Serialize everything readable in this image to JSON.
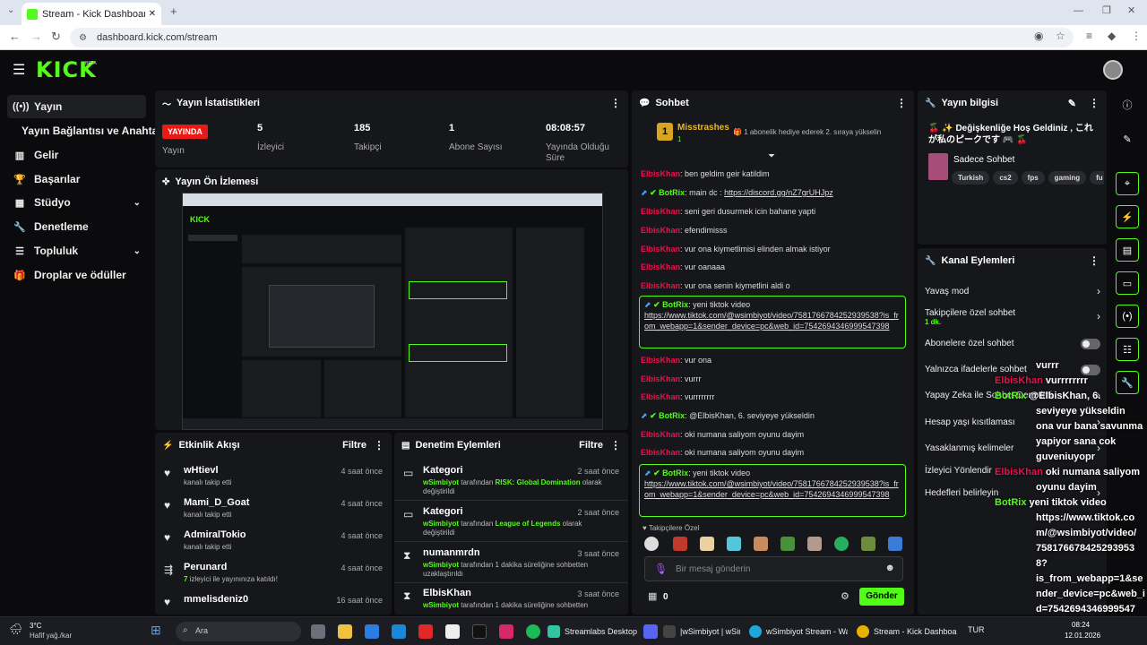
{
  "browser": {
    "tab_title": "Stream - Kick Dashboard",
    "url": "dashboard.kick.com/stream"
  },
  "header": {
    "logo": "KICK",
    "beta": "BETA"
  },
  "sidebar": {
    "items": [
      {
        "label": "Yayın",
        "icon": "broadcast-icon",
        "active": true
      },
      {
        "label": "Yayın Bağlantısı ve Anahtarı",
        "icon": "",
        "active": false
      },
      {
        "label": "Gelir",
        "icon": "revenue-icon",
        "active": false
      },
      {
        "label": "Başarılar",
        "icon": "trophy-icon",
        "active": false
      },
      {
        "label": "Stüdyo",
        "icon": "studio-icon",
        "active": false
      },
      {
        "label": "Denetleme",
        "icon": "wrench-icon",
        "active": false
      },
      {
        "label": "Topluluk",
        "icon": "community-icon",
        "active": false
      },
      {
        "label": "Droplar ve ödüller",
        "icon": "gift-icon",
        "active": false
      }
    ]
  },
  "stats": {
    "title": "Yayın İstatistikleri",
    "live": "YAYINDA",
    "live_label": "Yayın",
    "items": [
      {
        "value": "5",
        "label": "İzleyici"
      },
      {
        "value": "185",
        "label": "Takipçi"
      },
      {
        "value": "1",
        "label": "Abone Sayısı"
      },
      {
        "value": "08:08:57",
        "label": "Yayında Olduğu Süre"
      }
    ]
  },
  "preview": {
    "title": "Yayın Ön İzlemesi"
  },
  "activity": {
    "title": "Etkinlik Akışı",
    "filter": "Filtre",
    "items": [
      {
        "name": "wHtievl",
        "sub": "kanalı takip etti",
        "time": "4 saat önce",
        "icon": "heart-icon"
      },
      {
        "name": "Mami_D_Goat",
        "sub": "kanalı takip etti",
        "time": "4 saat önce",
        "icon": "heart-icon"
      },
      {
        "name": "AdmiralTokio",
        "sub": "kanalı takip etti",
        "time": "4 saat önce",
        "icon": "heart-icon"
      },
      {
        "name": "Perunard",
        "sub_green": "7",
        "sub": " izleyici ile yayınınıza katıldı!",
        "time": "4 saat önce",
        "icon": "raid-icon"
      },
      {
        "name": "mmelisdeniz0",
        "sub": "",
        "time": "16 saat önce",
        "icon": "heart-icon"
      }
    ]
  },
  "moderation": {
    "title": "Denetim Eylemleri",
    "filter": "Filtre",
    "items": [
      {
        "title": "Kategori",
        "user": "wSimbiyot",
        "mid": " tarafından ",
        "hl": "RISK: Global Domination",
        "end": " olarak değiştirildi",
        "time": "2 saat önce",
        "icon": "category-icon"
      },
      {
        "title": "Kategori",
        "user": "wSimbiyot",
        "mid": " tarafından ",
        "hl": "League of Legends",
        "end": " olarak değiştirildi",
        "time": "2 saat önce",
        "icon": "category-icon"
      },
      {
        "title": "numanmrdn",
        "user": "wSimbiyot",
        "mid": " tarafından 1 dakika süreliğine sohbetten uzaklaştırıldı",
        "hl": "",
        "end": "",
        "time": "3 saat önce",
        "icon": "hourglass-icon"
      },
      {
        "title": "ElbisKhan",
        "user": "wSimbiyot",
        "mid": " tarafından 1 dakika süreliğine sohbetten",
        "hl": "",
        "end": "",
        "time": "3 saat önce",
        "icon": "hourglass-icon"
      }
    ]
  },
  "chat": {
    "title": "Sohbet",
    "pinned": {
      "user": "Misstrashes",
      "count": "1",
      "text": "1 abonelik hediye ederek 2. sıraya yükselin"
    },
    "messages": [
      {
        "user": "ElbisKhan",
        "text": "ben geldim geir katildim"
      },
      {
        "user": "BotRix",
        "text": "main dc : ",
        "link": "https://discord.gg/nZ7grUHJpz",
        "bot": true
      },
      {
        "user": "ElbisKhan",
        "text": "seni geri dusurmek icin bahane yapti"
      },
      {
        "user": "ElbisKhan",
        "text": "efendimisss"
      },
      {
        "user": "ElbisKhan",
        "text": "vur ona kiymetlimisi elinden almak istiyor"
      },
      {
        "user": "ElbisKhan",
        "text": "vur oanaaa"
      },
      {
        "user": "ElbisKhan",
        "text": "vur ona senin kiymetlini aldi o"
      },
      {
        "user": "BotRix",
        "text": "yeni tiktok video",
        "link": "https://www.tiktok.com/@wsimbiyot/video/7581766784252939538?is_from_webapp=1&sender_device=pc&web_id=7542694346999547398",
        "bot": true
      },
      {
        "user": "ElbisKhan",
        "text": "vur ona"
      },
      {
        "user": "ElbisKhan",
        "text": "vurrr"
      },
      {
        "user": "ElbisKhan",
        "text": "vurrrrrrrr"
      },
      {
        "user": "BotRix",
        "text": "@ElbisKhan, 6. seviyeye yükseldin",
        "bot": true
      },
      {
        "user": "ElbisKhan",
        "text": "oki numana saliyom oyunu dayim"
      },
      {
        "user": "ElbisKhan",
        "text": "oki numana saliyom oyunu dayim"
      },
      {
        "user": "BotRix",
        "text": "yeni tiktok video",
        "link": "https://www.tiktok.com/@wsimbiyot/video/7581766784252939538?is_from_webapp=1&sender_device=pc&web_id=7542694346999547398",
        "bot": true
      }
    ],
    "followers_only": "Takipçilere Özel",
    "placeholder": "Bir mesaj gönderin",
    "count": "0",
    "send": "Gönder"
  },
  "info": {
    "title": "Yayın bilgisi",
    "stream_title": "🍒 ✨ Değişkenliğe Hoş Geldiniz , これが私のピークです 🎮 🍒",
    "category": "Sadece Sohbet",
    "tags": [
      "Turkish",
      "cs2",
      "fps",
      "gaming",
      "fu"
    ]
  },
  "channel_actions": {
    "title": "Kanal Eylemleri",
    "items": [
      {
        "label": "Yavaş mod",
        "type": "arrow"
      },
      {
        "label": "Takipçilere özel sohbet",
        "sub": "1 dk.",
        "type": "arrow"
      },
      {
        "label": "Abonelere özel sohbet",
        "type": "toggle"
      },
      {
        "label": "Yalnızca ifadelerle sohbet",
        "type": "toggle"
      },
      {
        "label": "Yapay Zeka ile Sohbet Denetimi",
        "type": "arrow"
      },
      {
        "label": "Hesap yaşı kısıtlaması",
        "type": "arrow"
      },
      {
        "label": "Yasaklanmış kelimeler",
        "type": "arrow"
      },
      {
        "label": "İzleyici Yönlendir",
        "type": "arrow"
      },
      {
        "label": "Hedefleri belirleyin",
        "type": "arrow"
      }
    ]
  },
  "overlay": {
    "lines": [
      "vurrr",
      "ElbisKhan vurrrrrrrr",
      "BotRix @ElbisKhan, 6.",
      "seviyeye yükseldin",
      "ona vur bana savunma",
      "yapiyor sana cok",
      "guveniuyopr",
      "ElbisKhan oki numana saliyom",
      "oyunu dayim",
      "BotRix yeni tiktok video",
      "https://www.tiktok.co",
      "m/@wsimbiyot/video/",
      "758176678425293953",
      "8?",
      "is_from_webapp=1&se",
      "nder_device=pc&web_i",
      "d=7542694346999547",
      "398"
    ]
  },
  "taskbar": {
    "weather_temp": "3°C",
    "weather_text": "Hafif yağ./kar",
    "search": "Ara",
    "apps": [
      "Streamlabs Desktop",
      "|wSimbiyot | wSim",
      "wSimbiyot Stream - Wa",
      "Stream - Kick Dashboar"
    ],
    "time": "08:24",
    "date": "12.01.2026",
    "lang": "TUR"
  },
  "colors": {
    "accent": "#53fc18",
    "live": "#e91916",
    "username": "#e9114c"
  }
}
